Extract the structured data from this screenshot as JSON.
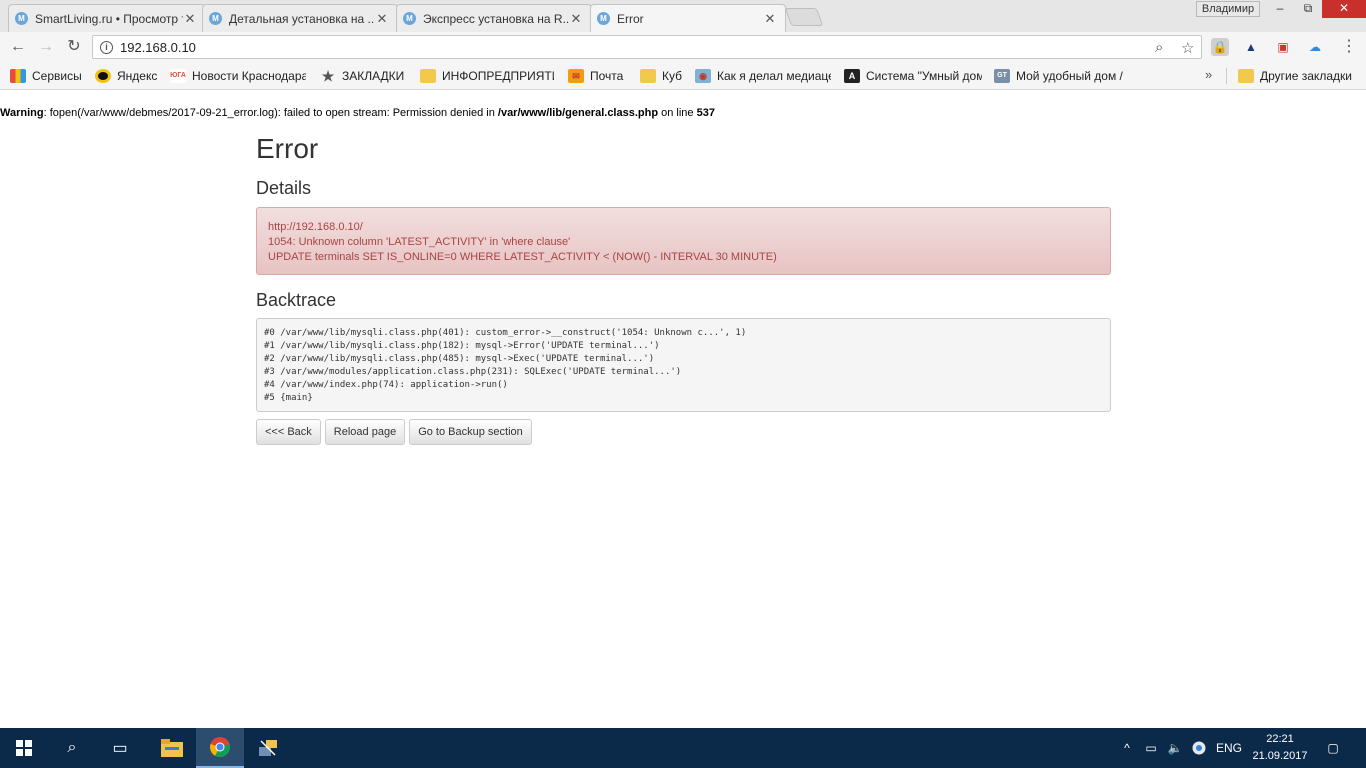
{
  "browser": {
    "tabs": [
      {
        "label": "SmartLiving.ru • Просмотр темы",
        "icon": "M"
      },
      {
        "label": "Детальная установка на ...",
        "icon": "M"
      },
      {
        "label": "Экспресс установка на R...",
        "icon": "M"
      },
      {
        "label": "Error",
        "icon": "M"
      }
    ],
    "user": "Владимир",
    "window_controls": {
      "minimize": "–",
      "restore": "⧉",
      "close": "✕"
    },
    "url": "192.168.0.10",
    "bookmarks": [
      {
        "label": "Сервисы",
        "icon": "apps-grid"
      },
      {
        "label": "Яндекс",
        "icon": "bee"
      },
      {
        "label": "Новости Краснодара",
        "icon": "news"
      },
      {
        "label": "ЗАКЛАДКИ",
        "icon": "star"
      },
      {
        "label": "ИНФОПРЕДПРИЯТИЕ",
        "icon": "folder"
      },
      {
        "label": "Почта",
        "icon": "mail"
      },
      {
        "label": "Куб",
        "icon": "folder"
      },
      {
        "label": "Как я делал медиацентр",
        "icon": "globe"
      },
      {
        "label": "Система \"Умный дом\"",
        "icon": "A"
      },
      {
        "label": "Мой удобный дом /",
        "icon": "GT"
      }
    ],
    "other_bookmarks": "Другие закладки",
    "more_bookmarks": "»"
  },
  "page": {
    "warning": {
      "label": "Warning",
      "text_before": ": fopen(/var/www/debmes/2017-09-21_error.log): failed to open stream: Permission denied in ",
      "file": "/var/www/lib/general.class.php",
      "text_mid": " on line ",
      "line": "537"
    },
    "title": "Error",
    "details_title": "Details",
    "details": {
      "line1": "http://192.168.0.10/",
      "line2": "1054: Unknown column 'LATEST_ACTIVITY' in 'where clause'",
      "line3": "UPDATE terminals SET IS_ONLINE=0 WHERE LATEST_ACTIVITY < (NOW() - INTERVAL 30 MINUTE)"
    },
    "backtrace_title": "Backtrace",
    "backtrace": [
      "#0 /var/www/lib/mysqli.class.php(401): custom_error->__construct('1054: Unknown c...', 1)",
      "#1 /var/www/lib/mysqli.class.php(182): mysql->Error('UPDATE terminal...')",
      "#2 /var/www/lib/mysqli.class.php(485): mysql->Exec('UPDATE terminal...')",
      "#3 /var/www/modules/application.class.php(231): SQLExec('UPDATE terminal...')",
      "#4 /var/www/index.php(74): application->run()",
      "#5 {main}"
    ],
    "buttons": {
      "back": "<<< Back",
      "reload": "Reload page",
      "backup": "Go to Backup section"
    }
  },
  "taskbar": {
    "language": "ENG",
    "time": "22:21",
    "date": "21.09.2017"
  },
  "colors": {
    "alert_text": "#a94442",
    "alert_bg": "#f2dede",
    "taskbar": "#0b2a4a"
  }
}
